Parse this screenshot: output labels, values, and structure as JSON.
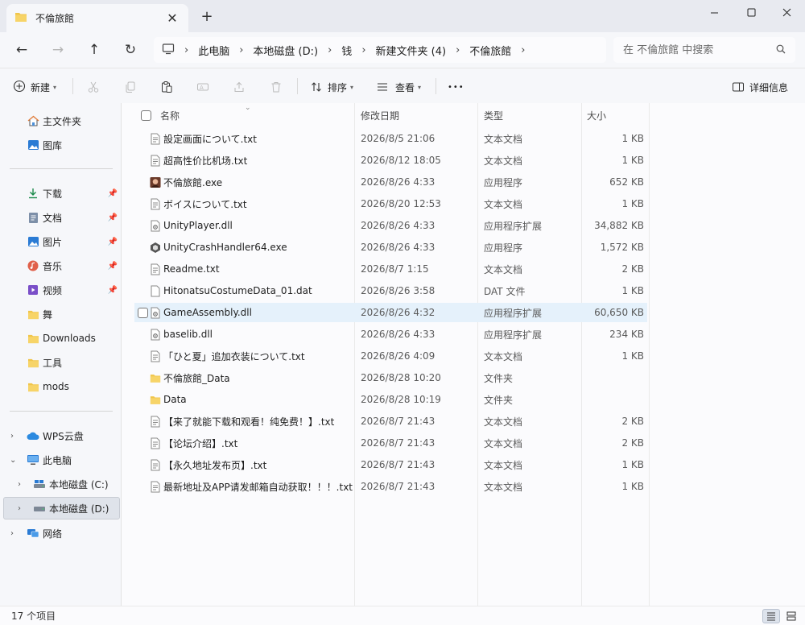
{
  "window": {
    "tab_title": "不倫旅館",
    "colors": {
      "accent": "#0067c0",
      "folder": "#f0c54a",
      "selection": "#e5f1fb"
    }
  },
  "nav": {
    "breadcrumb": [
      "此电脑",
      "本地磁盘 (D:)",
      "钱",
      "新建文件夹 (4)",
      "不倫旅館"
    ],
    "search_placeholder": "在 不倫旅館 中搜索"
  },
  "toolbar": {
    "new_label": "新建",
    "sort_label": "排序",
    "view_label": "查看",
    "more_label": "•••",
    "details_label": "详细信息"
  },
  "sidebar": {
    "top": [
      {
        "label": "主文件夹",
        "icon": "home-icon"
      },
      {
        "label": "图库",
        "icon": "gallery-icon"
      }
    ],
    "quick": [
      {
        "label": "下载",
        "icon": "download-icon",
        "pinned": true
      },
      {
        "label": "文档",
        "icon": "document-icon",
        "pinned": true
      },
      {
        "label": "图片",
        "icon": "picture-icon",
        "pinned": true
      },
      {
        "label": "音乐",
        "icon": "music-icon",
        "pinned": true
      },
      {
        "label": "视频",
        "icon": "video-icon",
        "pinned": true
      },
      {
        "label": "舞",
        "icon": "folder-icon",
        "pinned": false
      },
      {
        "label": "Downloads",
        "icon": "folder-icon",
        "pinned": false
      },
      {
        "label": "工具",
        "icon": "folder-icon",
        "pinned": false
      },
      {
        "label": "mods",
        "icon": "folder-icon",
        "pinned": false
      }
    ],
    "tree": [
      {
        "label": "WPS云盘",
        "icon": "cloud-icon",
        "expanded": false
      },
      {
        "label": "此电脑",
        "icon": "computer-icon",
        "expanded": true
      },
      {
        "label": "本地磁盘 (C:)",
        "icon": "drive-icon",
        "expanded": false
      },
      {
        "label": "本地磁盘 (D:)",
        "icon": "drive-icon",
        "expanded": false,
        "selected": true
      },
      {
        "label": "网络",
        "icon": "network-icon",
        "expanded": false
      }
    ]
  },
  "columns": {
    "name": "名称",
    "date": "修改日期",
    "type": "类型",
    "size": "大小"
  },
  "files": [
    {
      "name": "設定画面について.txt",
      "date": "2026/8/5 21:06",
      "type": "文本文档",
      "size": "1 KB",
      "icon": "text-file-icon"
    },
    {
      "name": "超高性价比机场.txt",
      "date": "2026/8/12 18:05",
      "type": "文本文档",
      "size": "1 KB",
      "icon": "text-file-icon"
    },
    {
      "name": "不倫旅館.exe",
      "date": "2026/8/26 4:33",
      "type": "应用程序",
      "size": "652 KB",
      "icon": "app-icon"
    },
    {
      "name": "ボイスについて.txt",
      "date": "2026/8/20 12:53",
      "type": "文本文档",
      "size": "1 KB",
      "icon": "text-file-icon"
    },
    {
      "name": "UnityPlayer.dll",
      "date": "2026/8/26 4:33",
      "type": "应用程序扩展",
      "size": "34,882 KB",
      "icon": "dll-file-icon"
    },
    {
      "name": "UnityCrashHandler64.exe",
      "date": "2026/8/26 4:33",
      "type": "应用程序",
      "size": "1,572 KB",
      "icon": "unity-icon"
    },
    {
      "name": "Readme.txt",
      "date": "2026/8/7 1:15",
      "type": "文本文档",
      "size": "2 KB",
      "icon": "text-file-icon"
    },
    {
      "name": "HitonatsuCostumeData_01.dat",
      "date": "2026/8/26 3:58",
      "type": "DAT 文件",
      "size": "1 KB",
      "icon": "blank-file-icon"
    },
    {
      "name": "GameAssembly.dll",
      "date": "2026/8/26 4:32",
      "type": "应用程序扩展",
      "size": "60,650 KB",
      "icon": "dll-file-icon",
      "hover": true
    },
    {
      "name": "baselib.dll",
      "date": "2026/8/26 4:33",
      "type": "应用程序扩展",
      "size": "234 KB",
      "icon": "dll-file-icon"
    },
    {
      "name": "「ひと夏」追加衣装について.txt",
      "date": "2026/8/26 4:09",
      "type": "文本文档",
      "size": "1 KB",
      "icon": "text-file-icon"
    },
    {
      "name": "不倫旅館_Data",
      "date": "2026/8/28 10:20",
      "type": "文件夹",
      "size": "",
      "icon": "folder-icon"
    },
    {
      "name": "Data",
      "date": "2026/8/28 10:19",
      "type": "文件夹",
      "size": "",
      "icon": "folder-icon"
    },
    {
      "name": "【来了就能下载和观看！纯免费！】.txt",
      "date": "2026/8/7 21:43",
      "type": "文本文档",
      "size": "2 KB",
      "icon": "text-file-icon"
    },
    {
      "name": "【论坛介绍】.txt",
      "date": "2026/8/7 21:43",
      "type": "文本文档",
      "size": "2 KB",
      "icon": "text-file-icon"
    },
    {
      "name": "【永久地址发布页】.txt",
      "date": "2026/8/7 21:43",
      "type": "文本文档",
      "size": "1 KB",
      "icon": "text-file-icon"
    },
    {
      "name": "最新地址及APP请发邮箱自动获取！！！.txt",
      "date": "2026/8/7 21:43",
      "type": "文本文档",
      "size": "1 KB",
      "icon": "text-file-icon"
    }
  ],
  "status": {
    "count": "17 个项目"
  }
}
